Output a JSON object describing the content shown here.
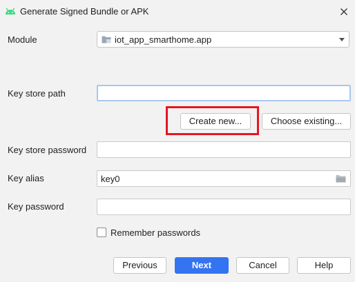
{
  "window": {
    "title": "Generate Signed Bundle or APK",
    "app_icon": "android-icon",
    "close_icon": "close-icon"
  },
  "module": {
    "label": "Module",
    "value": "iot_app_smarthome.app",
    "icon": "module-folder-icon"
  },
  "key_store_path": {
    "label": "Key store path",
    "value": "",
    "create_new_label": "Create new...",
    "choose_existing_label": "Choose existing..."
  },
  "key_store_password": {
    "label": "Key store password",
    "value": ""
  },
  "key_alias": {
    "label": "Key alias",
    "value": "key0",
    "browse_icon": "folder-icon"
  },
  "key_password": {
    "label": "Key password",
    "value": ""
  },
  "remember_passwords": {
    "label": "Remember passwords",
    "checked": false
  },
  "buttons": {
    "previous": "Previous",
    "next": "Next",
    "cancel": "Cancel",
    "help": "Help"
  },
  "colors": {
    "accent": "#3574f0",
    "highlight_box": "#e8141e",
    "android_green": "#3ddc84",
    "background": "#f2f2f2"
  }
}
